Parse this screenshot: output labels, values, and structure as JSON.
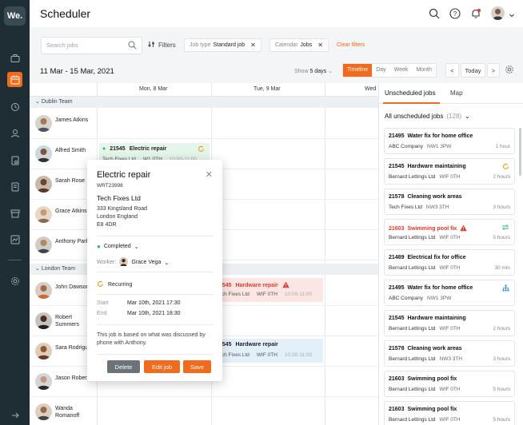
{
  "app": {
    "logo": "We.",
    "title": "Scheduler"
  },
  "nav": {
    "items": [
      "briefcase-icon",
      "calendar-icon",
      "clock-icon",
      "contacts-icon",
      "document-icon",
      "notes-icon",
      "archive-icon",
      "chart-icon",
      "settings-icon",
      "collapse-icon"
    ]
  },
  "header": {
    "icons": [
      "search-icon",
      "help-icon",
      "bell-icon",
      "user-avatar"
    ]
  },
  "filters": {
    "search_placeholder": "Search jobs",
    "filters_label": "Filters",
    "chip_jobtype_key": "Job type",
    "chip_jobtype_value": "Standard job",
    "chip_calendar_key": "Calendar",
    "chip_calendar_value": "Jobs",
    "clear_label": "Clear filters"
  },
  "toolbar": {
    "date_range": "11 Mar - 15 Mar, 2021",
    "show_label": "Show",
    "show_value": "5 days",
    "views": [
      "Timeline",
      "Day",
      "Week",
      "Month"
    ],
    "active_view": "Timeline",
    "prev": "<",
    "today": "Today",
    "next": ">"
  },
  "calendar": {
    "days": [
      "Mon, 8 Mar",
      "Tue, 9 Mar",
      "Wed"
    ],
    "teams": [
      {
        "name": "Dublin Team",
        "workers": [
          "James Atkins",
          "Alfred Smith",
          "Sarah Rose",
          "Grace Atkinson",
          "Anthony Parker"
        ]
      },
      {
        "name": "London Team",
        "workers": [
          "John Dawson",
          "Robert Summers",
          "Sara Rodriguez",
          "Jason Roberts",
          "Wanda Romanoff"
        ]
      }
    ],
    "jobs": [
      {
        "id": "21545",
        "title": "Electric repair",
        "company": "Tech Fixes Ltd",
        "postcode": "W1 0TH",
        "time": "10:00-11:00"
      },
      {
        "id": "21545",
        "title": "Hardware repair",
        "company": "Tech Fixes Ltd",
        "postcode": "WIF 0TH",
        "time": "10:00-11:00"
      },
      {
        "id": "21545",
        "title": "Hardware repair",
        "company": "Tech Fixes Ltd",
        "postcode": "WIF 0TH",
        "time": "10:00-11:00"
      }
    ]
  },
  "popup": {
    "title": "Electric repair",
    "ref": "WRT23998",
    "company": "Tech Fixes Ltd",
    "address_line1": "333 Kingsland Road",
    "address_line2": "London England",
    "address_line3": "E8 4DR",
    "status": "Completed",
    "worker_label": "Worker:",
    "worker_name": "Grace Vega",
    "recurring": "Recurring",
    "start_label": "Start",
    "start_value": "Mar 10th, 2021 17:30",
    "end_label": "End",
    "end_value": "Mar 10th, 2021 18:30",
    "note": "This job is based on what was discussed by phone with Anthony.",
    "delete_label": "Delete",
    "edit_label": "Edit job",
    "save_label": "Save"
  },
  "right_panel": {
    "tab_unscheduled": "Unscheduled jobs",
    "tab_map": "Map",
    "all_label": "All unscheduled jobs",
    "all_count": "(128)",
    "cards": [
      {
        "id": "21495",
        "title": "Water fix for home office",
        "company": "ABC Company",
        "postcode": "NW1 3PW",
        "duration": "1 hour",
        "icon": "",
        "urgent": false
      },
      {
        "id": "21545",
        "title": "Hardware maintaining",
        "company": "Bernard Lettings Ltd",
        "postcode": "WIF 0TH",
        "duration": "2 hours",
        "icon": "recurring-icon",
        "urgent": false
      },
      {
        "id": "21578",
        "title": "Cleaning work areas",
        "company": "Tech Fixes Ltd",
        "postcode": "NW3 3TH",
        "duration": "3 hours",
        "icon": "",
        "urgent": false
      },
      {
        "id": "21603",
        "title": "Swimming pool fix",
        "company": "Bernard Lettings Ltd",
        "postcode": "WIF 0TH",
        "duration": "5 hours",
        "icon": "repeat-icon",
        "urgent": true
      },
      {
        "id": "21489",
        "title": "Electrical fix for office",
        "company": "Bernard Lettings Ltd",
        "postcode": "WIF 0TH",
        "duration": "30 min",
        "icon": "",
        "urgent": false
      },
      {
        "id": "21495",
        "title": "Water fix for home office",
        "company": "ABC Company",
        "postcode": "NW1 3PW",
        "duration": "",
        "icon": "hierarchy-icon",
        "urgent": false
      },
      {
        "id": "21545",
        "title": "Hardware maintaining",
        "company": "Bernard Lettings Ltd",
        "postcode": "WIF 0TH",
        "duration": "2 hours",
        "icon": "",
        "urgent": false
      },
      {
        "id": "21578",
        "title": "Cleaning work areas",
        "company": "Bernard Lettings Ltd",
        "postcode": "NW3 3TH",
        "duration": "3 hours",
        "icon": "",
        "urgent": false
      },
      {
        "id": "21603",
        "title": "Swimming pool fix",
        "company": "Bernard Lettings Ltd",
        "postcode": "WIF 0TH",
        "duration": "5 hours",
        "icon": "",
        "urgent": false
      },
      {
        "id": "21603",
        "title": "Swimming pool fix",
        "company": "Bernard Lettings Ltd",
        "postcode": "WIF 0TH",
        "duration": "5 hours",
        "icon": "",
        "urgent": false
      }
    ]
  },
  "colors": {
    "accent": "#f26a1b",
    "nav_bg": "#1f2d35",
    "completed": "#2bb673",
    "urgent": "#e5392a",
    "info": "#2b88d8"
  }
}
